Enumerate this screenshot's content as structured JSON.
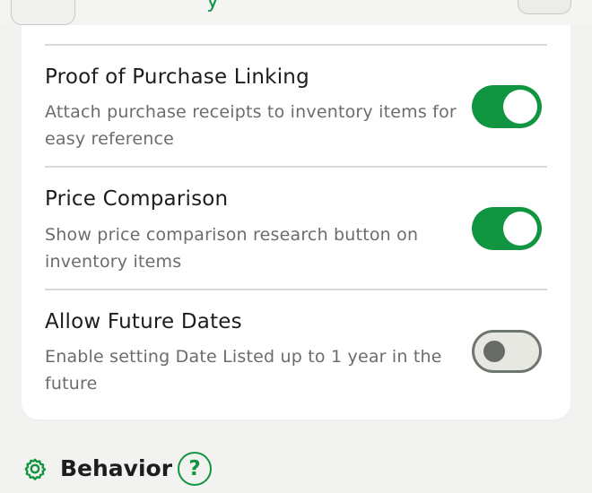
{
  "header": {
    "left_button_label": "",
    "title_fragment": "y",
    "right_button_label": ""
  },
  "settings_card": {
    "cutoff_text": "",
    "items": [
      {
        "title": "Proof of Purchase Linking",
        "description": "Attach purchase receipts to inventory items for easy reference",
        "enabled": true
      },
      {
        "title": "Price Comparison",
        "description": "Show price comparison research button on inventory items",
        "enabled": true
      },
      {
        "title": "Allow Future Dates",
        "description": "Enable setting Date Listed up to 1 year in the future",
        "enabled": false
      }
    ]
  },
  "behavior_section": {
    "title": "Behavior",
    "icon": "gear-icon",
    "help_label": "?"
  },
  "colors": {
    "accent": "#129540",
    "page_background": "#f2f2f0",
    "card_background": "#ffffff",
    "toggle_off_background": "#e8e8e2",
    "toggle_off_border": "#6f756f",
    "secondary_text": "#6c6c6c",
    "primary_text": "#1d1d1f"
  }
}
